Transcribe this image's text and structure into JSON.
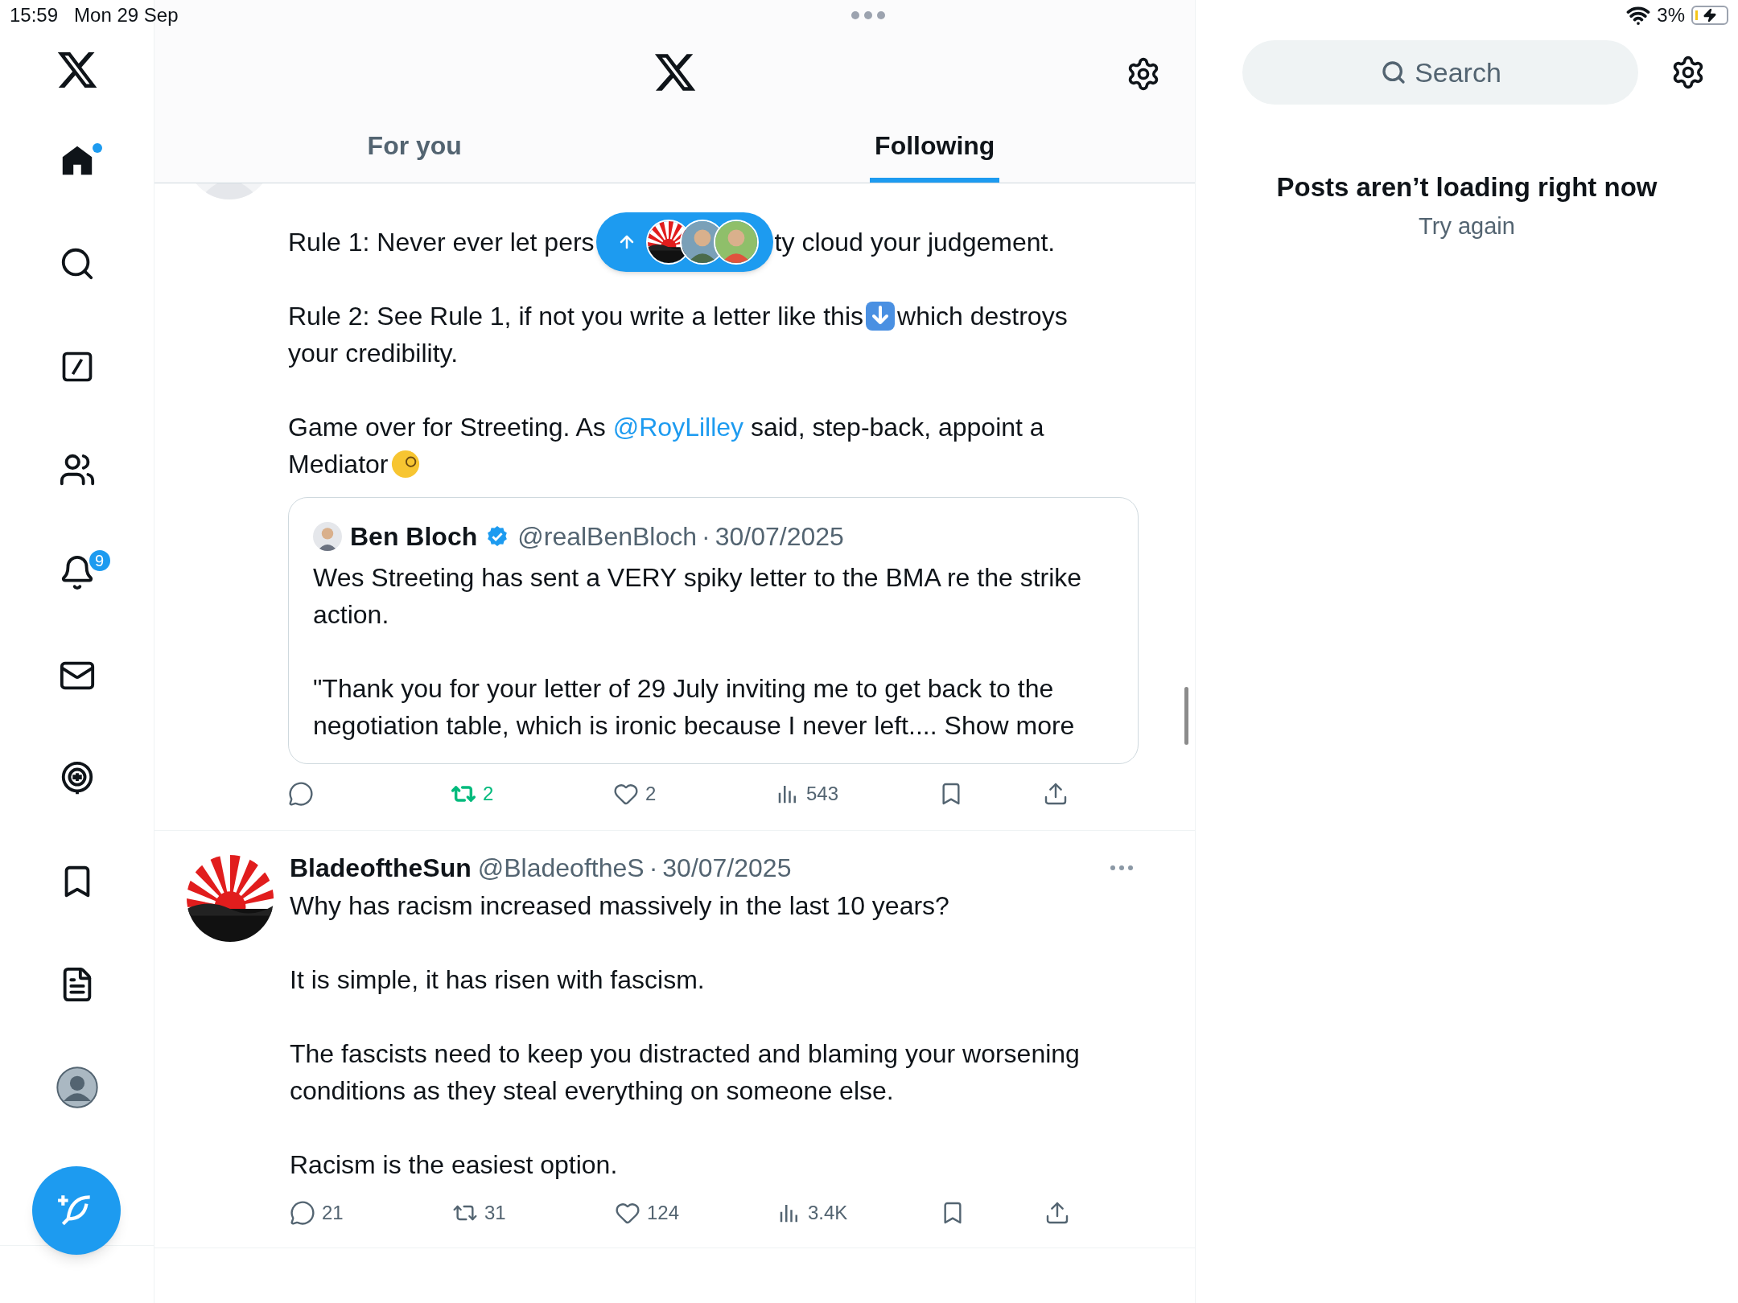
{
  "status_bar": {
    "time": "15:59",
    "date": "Mon 29 Sep",
    "battery": "3%",
    "charging": true
  },
  "sidebar": {
    "items": [
      {
        "kind": "home",
        "selected": true,
        "dot": true
      },
      {
        "kind": "search",
        "selected": false,
        "dot": false
      },
      {
        "kind": "grok",
        "selected": false,
        "dot": false
      },
      {
        "kind": "communities",
        "selected": false,
        "dot": false
      },
      {
        "kind": "notifications",
        "selected": false,
        "dot": false,
        "badge": "9"
      },
      {
        "kind": "messages",
        "selected": false,
        "dot": false
      },
      {
        "kind": "spaces",
        "selected": false,
        "dot": false
      },
      {
        "kind": "bookmarks",
        "selected": false,
        "dot": false
      },
      {
        "kind": "lists",
        "selected": false,
        "dot": false
      },
      {
        "kind": "profile",
        "selected": false,
        "dot": false
      }
    ]
  },
  "header": {
    "tabs": [
      {
        "label": "For you",
        "selected": false
      },
      {
        "label": "Following",
        "selected": true
      }
    ]
  },
  "tweets": [
    {
      "paragraphs": [
        [
          [
            {
              "kind": "text",
              "text": "Rule 1: Never ever let pers"
            },
            {
              "kind": "gap"
            },
            {
              "kind": "text",
              "text": "ty cloud your judgement."
            }
          ]
        ],
        [
          [
            {
              "kind": "text",
              "text": "Rule 2: See Rule 1, if not you write a letter like this"
            },
            {
              "kind": "arrow_emoji"
            },
            {
              "kind": "text",
              "text": "which destroys"
            }
          ],
          [
            {
              "kind": "text",
              "text": "your credibility."
            }
          ]
        ],
        [
          [
            {
              "kind": "text",
              "text": "Game over for Streeting. As "
            },
            {
              "kind": "link",
              "text": "@RoyLilley"
            },
            {
              "kind": "text",
              "text": " said, step-back, appoint a"
            }
          ],
          [
            {
              "kind": "text",
              "text": "Mediator"
            },
            {
              "kind": "face_emoji"
            }
          ]
        ]
      ],
      "quote": {
        "author": "Ben Bloch",
        "verified": true,
        "handle": "@realBenBloch",
        "separator": "·",
        "date": "30/07/2025",
        "paragraphs": [
          [
            "Wes Streeting has sent a VERY spiky letter to the BMA re the strike",
            "action."
          ],
          [
            "\"Thank you for your letter of 29 July inviting me to get back to the",
            "negotiation table, which is ironic because I never left...."
          ]
        ],
        "show_more": "Show more"
      },
      "actions": [
        {
          "kind": "reply"
        },
        {
          "kind": "repost",
          "count": "2",
          "active": true
        },
        {
          "kind": "like",
          "count": "2",
          "active": false
        },
        {
          "kind": "views",
          "count": "543"
        },
        {
          "kind": "bookmark"
        },
        {
          "kind": "share"
        }
      ]
    },
    {
      "author": "BladeoftheSun",
      "handle": "@BladeoftheS",
      "separator": "·",
      "date": "30/07/2025",
      "paragraphs": [
        [
          [
            {
              "kind": "text",
              "text": "Why has racism increased massively in the last 10 years?"
            }
          ]
        ],
        [
          [
            {
              "kind": "text",
              "text": "It is simple, it has risen with fascism."
            }
          ]
        ],
        [
          [
            {
              "kind": "text",
              "text": "The fascists need to keep you distracted and blaming your worsening"
            }
          ],
          [
            {
              "kind": "text",
              "text": "conditions as they steal everything on someone else."
            }
          ]
        ],
        [
          [
            {
              "kind": "text",
              "text": "Racism is the easiest option."
            }
          ]
        ]
      ],
      "actions": [
        {
          "kind": "reply",
          "count": "21"
        },
        {
          "kind": "repost",
          "count": "31",
          "active": false
        },
        {
          "kind": "like",
          "count": "124",
          "active": false
        },
        {
          "kind": "views",
          "count": "3.4K"
        },
        {
          "kind": "bookmark"
        },
        {
          "kind": "share"
        }
      ]
    }
  ],
  "right_panel": {
    "search": {
      "placeholder": "Search"
    },
    "error_title": "Posts aren’t loading right now",
    "retry": "Try again"
  }
}
